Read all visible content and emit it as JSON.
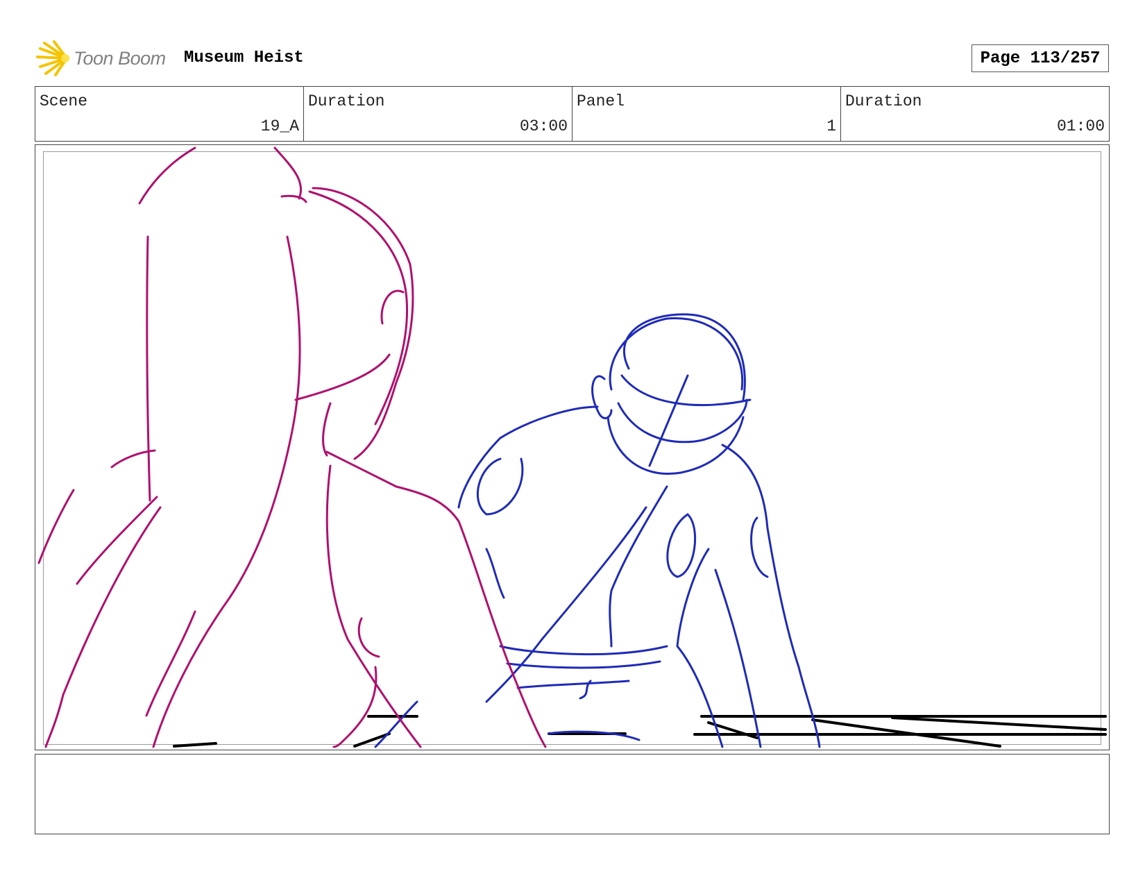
{
  "header": {
    "logo_text": "Toon Boom",
    "project_title": "Museum Heist",
    "page_label": "Page 113/257"
  },
  "info": [
    {
      "label": "Scene",
      "value": "19_A"
    },
    {
      "label": "Duration",
      "value": "03:00"
    },
    {
      "label": "Panel",
      "value": "1"
    },
    {
      "label": "Duration",
      "value": "01:00"
    }
  ],
  "colors": {
    "foreground_figure": "#b0106e",
    "background_figure": "#1f2bb8",
    "ground_lines": "#000000",
    "logo_burst": "#f5c400"
  },
  "notes": ""
}
